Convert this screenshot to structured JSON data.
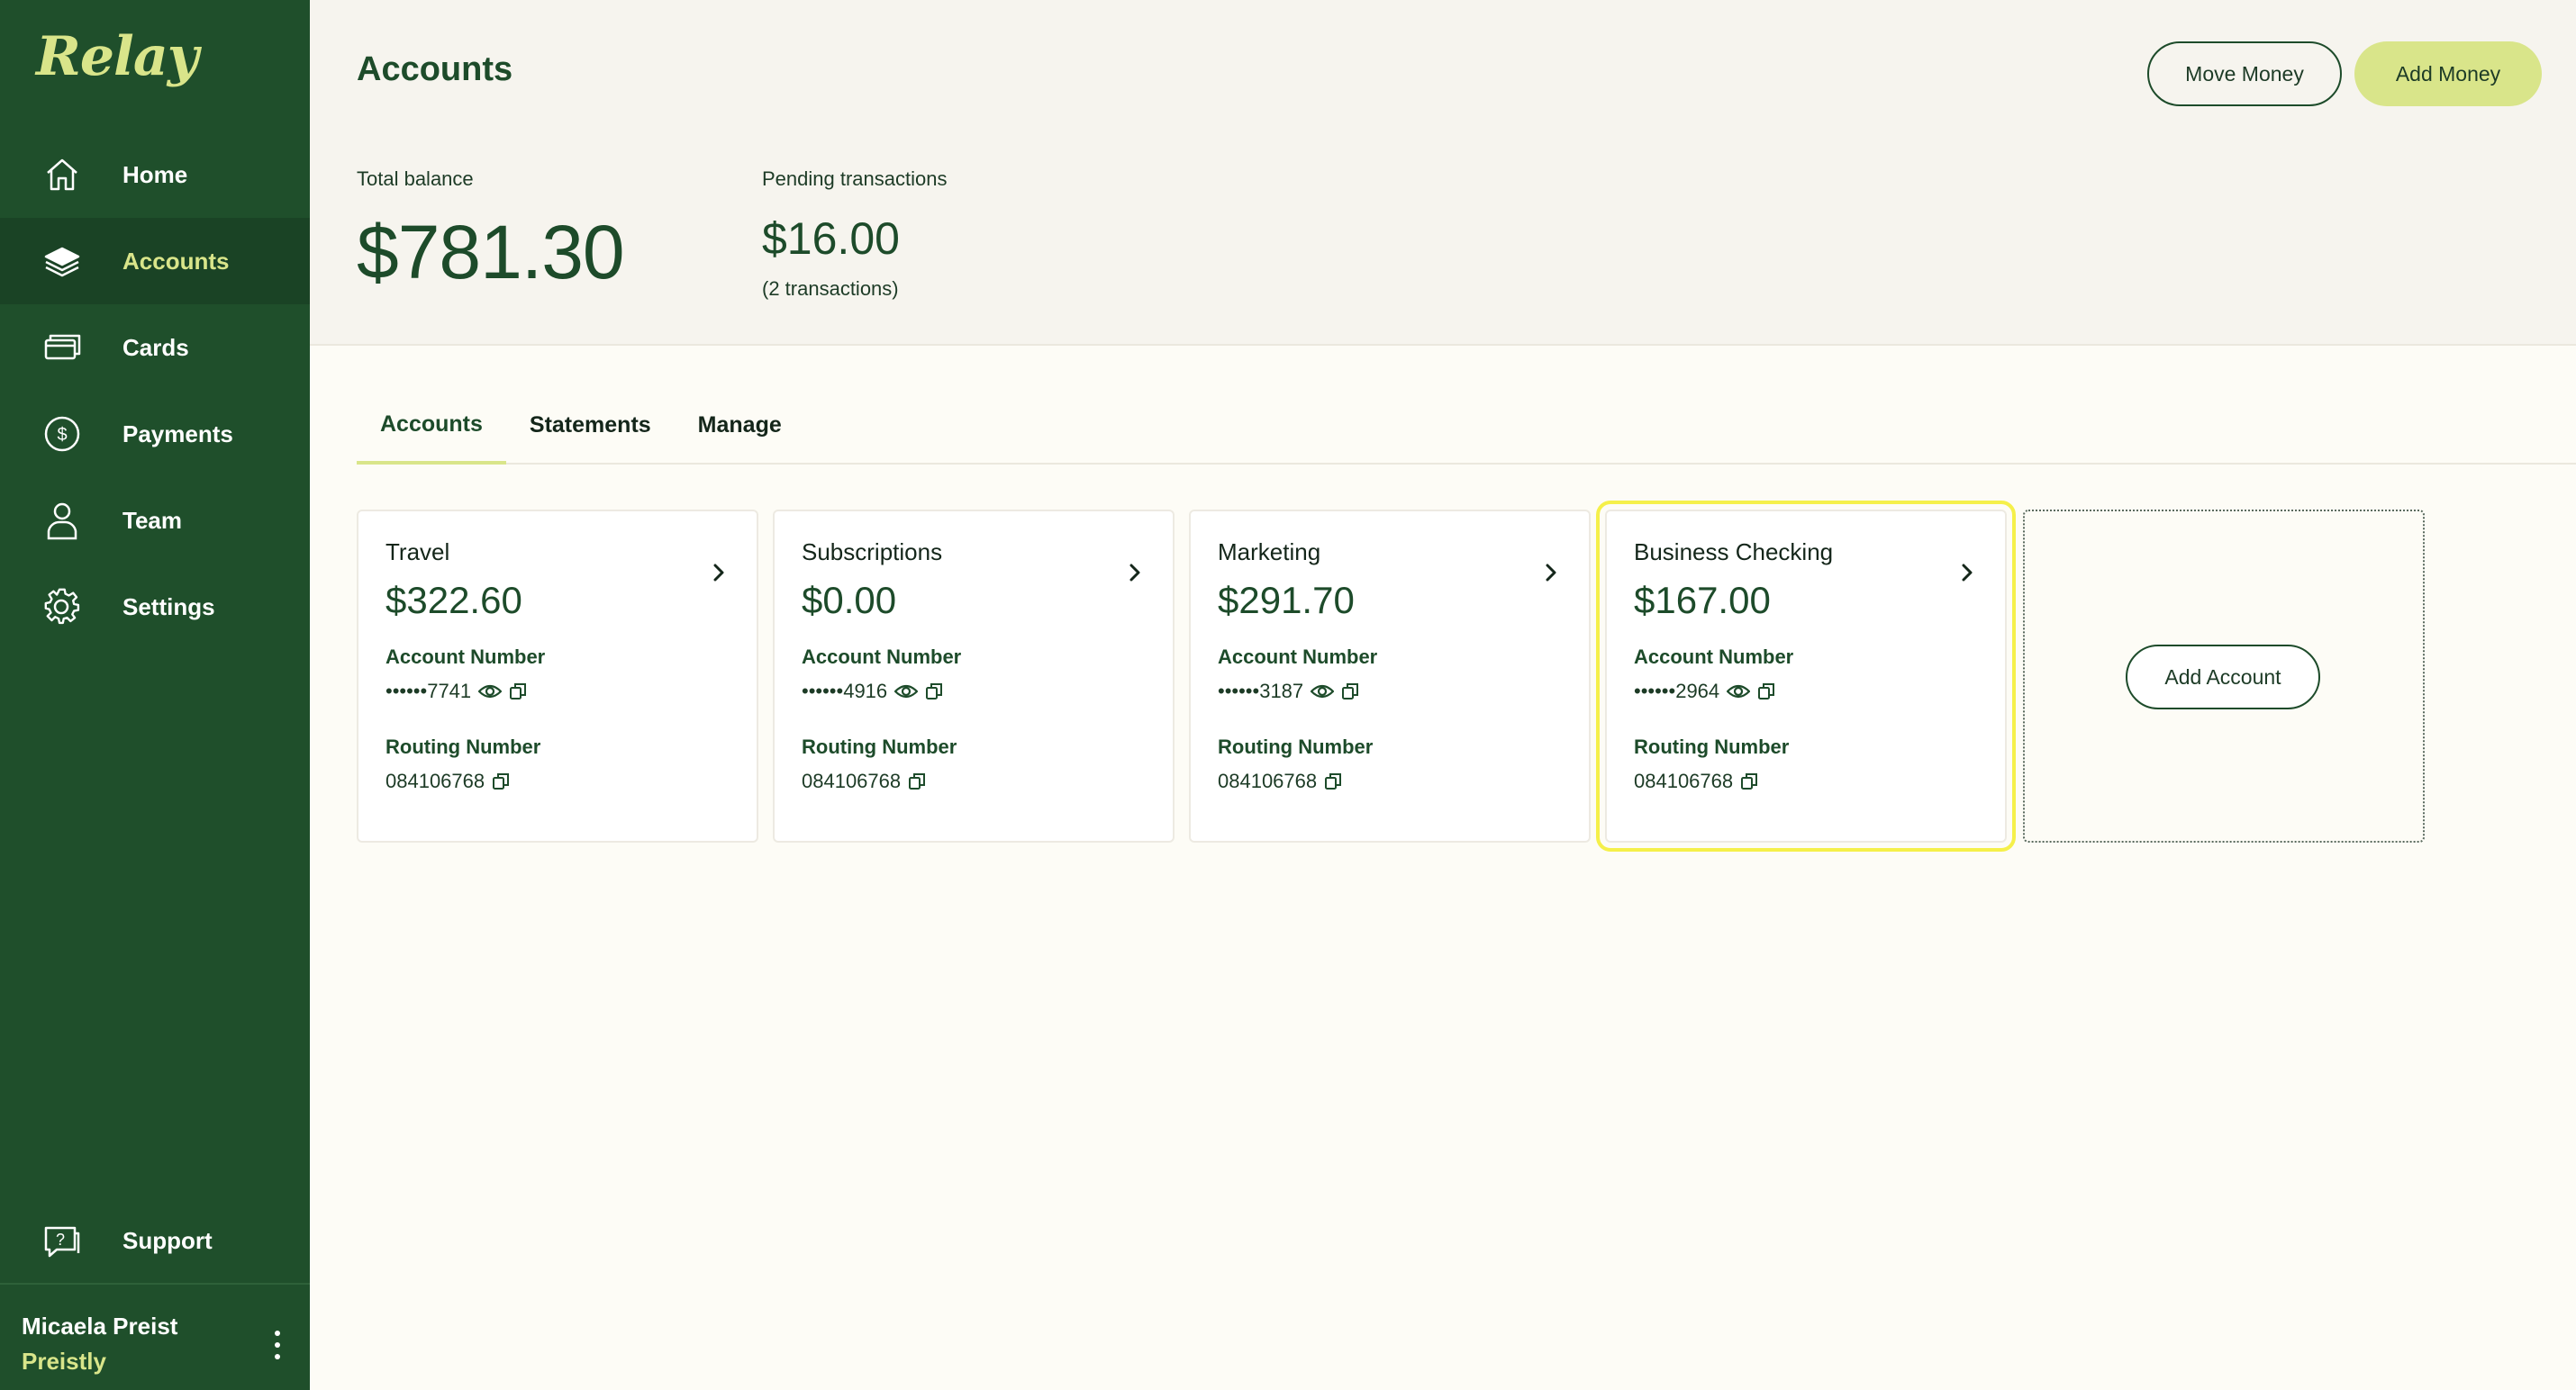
{
  "app": {
    "logo": "Relay"
  },
  "sidebar": {
    "items": [
      {
        "label": "Home",
        "icon": "home-icon",
        "active": false
      },
      {
        "label": "Accounts",
        "icon": "layers-icon",
        "active": true
      },
      {
        "label": "Cards",
        "icon": "cards-icon",
        "active": false
      },
      {
        "label": "Payments",
        "icon": "dollar-circle-icon",
        "active": false
      },
      {
        "label": "Team",
        "icon": "person-icon",
        "active": false
      },
      {
        "label": "Settings",
        "icon": "gear-icon",
        "active": false
      }
    ],
    "support": {
      "label": "Support",
      "icon": "help-chat-icon"
    },
    "user": {
      "name": "Micaela Preist",
      "company": "Preistly"
    }
  },
  "header": {
    "title": "Accounts",
    "move_money_label": "Move Money",
    "add_money_label": "Add Money",
    "total_balance_label": "Total balance",
    "total_balance": "$781.30",
    "pending_label": "Pending transactions",
    "pending_amount": "$16.00",
    "pending_count": "(2 transactions)"
  },
  "tabs": [
    {
      "label": "Accounts",
      "active": true
    },
    {
      "label": "Statements",
      "active": false
    },
    {
      "label": "Manage",
      "active": false
    }
  ],
  "accounts": [
    {
      "name": "Travel",
      "balance": "$322.60",
      "account_number_label": "Account Number",
      "account_number": "••••••7741",
      "routing_number_label": "Routing Number",
      "routing_number": "084106768"
    },
    {
      "name": "Subscriptions",
      "balance": "$0.00",
      "account_number_label": "Account Number",
      "account_number": "••••••4916",
      "routing_number_label": "Routing Number",
      "routing_number": "084106768"
    },
    {
      "name": "Marketing",
      "balance": "$291.70",
      "account_number_label": "Account Number",
      "account_number": "••••••3187",
      "routing_number_label": "Routing Number",
      "routing_number": "084106768"
    },
    {
      "name": "Business Checking",
      "balance": "$167.00",
      "account_number_label": "Account Number",
      "account_number": "••••••2964",
      "routing_number_label": "Routing Number",
      "routing_number": "084106768"
    }
  ],
  "add_account_label": "Add Account",
  "colors": {
    "sidebar_bg": "#1f4f2b",
    "accent": "#d9e58a",
    "text_dark_green": "#1d4b2a",
    "highlight": "#f5f04a"
  }
}
